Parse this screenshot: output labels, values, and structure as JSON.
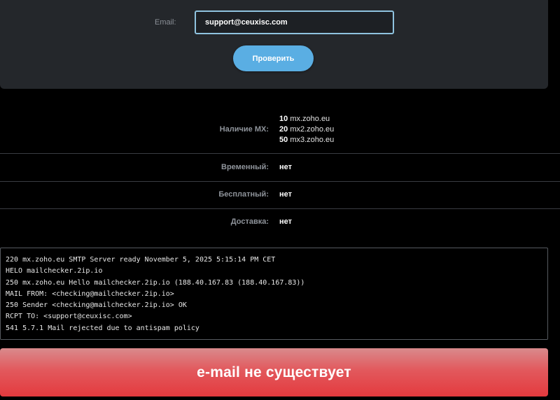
{
  "form": {
    "email_label": "Email:",
    "email_value": "support@ceuxisc.com",
    "check_button": "Проверить"
  },
  "results": {
    "mx_label": "Наличие MX:",
    "mx_records": [
      {
        "priority": "10",
        "host": "mx.zoho.eu"
      },
      {
        "priority": "20",
        "host": "mx2.zoho.eu"
      },
      {
        "priority": "50",
        "host": "mx3.zoho.eu"
      }
    ],
    "temporary_label": "Временный:",
    "temporary_value": "нет",
    "free_label": "Бесплатный:",
    "free_value": "нет",
    "delivery_label": "Доставка:",
    "delivery_value": "нет"
  },
  "smtp_log": [
    "220 mx.zoho.eu SMTP Server ready November 5, 2025 5:15:14 PM CET",
    "HELO mailchecker.2ip.io",
    "250 mx.zoho.eu Hello mailchecker.2ip.io (188.40.167.83 (188.40.167.83))",
    "MAIL FROM: <checking@mailchecker.2ip.io>",
    "250 Sender <checking@mailchecker.2ip.io> OK",
    "RCPT TO: <support@ceuxisc.com>",
    "541 5.7.1 Mail rejected due to antispam policy"
  ],
  "result": {
    "text": "e-mail не существует",
    "color": "#e43a3e"
  },
  "colors": {
    "accent": "#5aaee3",
    "input_border": "#8fc3df",
    "panel": "#24272b",
    "background": "#000000"
  }
}
